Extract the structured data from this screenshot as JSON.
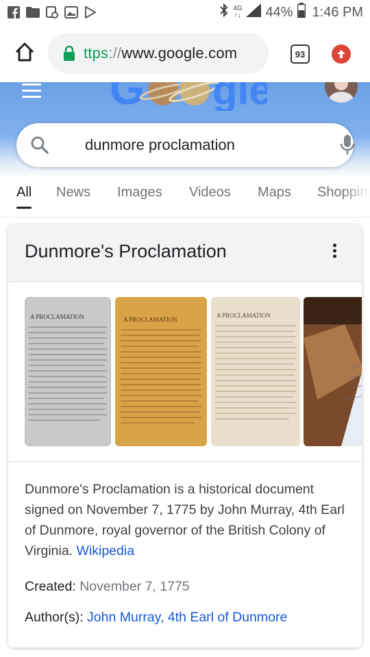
{
  "status_bar": {
    "battery_percent": "44%",
    "time": "1:46 PM",
    "icons": [
      "facebook-icon",
      "folder-icon",
      "sync-icon",
      "image-icon",
      "play-store-icon",
      "bluetooth-icon",
      "data-icon",
      "signal-icon",
      "battery-icon"
    ]
  },
  "browser": {
    "url_scheme": "ttps",
    "url_sep": "://",
    "url_host": "www.google.com",
    "tab_count": "93"
  },
  "search": {
    "query": "dunmore proclamation"
  },
  "tabs": [
    {
      "label": "All",
      "active": true
    },
    {
      "label": "News",
      "active": false
    },
    {
      "label": "Images",
      "active": false
    },
    {
      "label": "Videos",
      "active": false
    },
    {
      "label": "Maps",
      "active": false
    },
    {
      "label": "Shopping",
      "active": false
    }
  ],
  "knowledge_panel": {
    "title": "Dunmore's Proclamation",
    "description": "Dunmore's Proclamation is a historical document signed on November 7, 1775 by John Murray, 4th Earl of Dunmore, royal governor of the British Colony of Virginia. ",
    "source_link": "Wikipedia",
    "created_label": "Created: ",
    "created_value": "November 7, 1775",
    "author_label": "Author(s): ",
    "author_value": "John Murray, 4th Earl of Dunmore",
    "image_heading": "A PROCLAMATION",
    "images": [
      {
        "name": "proclamation-grayscale",
        "bg": "#c9c9c9",
        "ink": "#4d4d4d"
      },
      {
        "name": "proclamation-sepia",
        "bg": "#d9a448",
        "ink": "#6b4214"
      },
      {
        "name": "proclamation-light",
        "bg": "#eadfcc",
        "ink": "#8a6f57"
      },
      {
        "name": "proclamation-photo",
        "bg": "#7a4a2a",
        "ink": "#5a6b8a"
      }
    ]
  },
  "colors": {
    "header_blue": "#6aa0e6",
    "link_blue": "#1558d6",
    "url_green": "#0f9d58",
    "update_red": "#db4437"
  }
}
